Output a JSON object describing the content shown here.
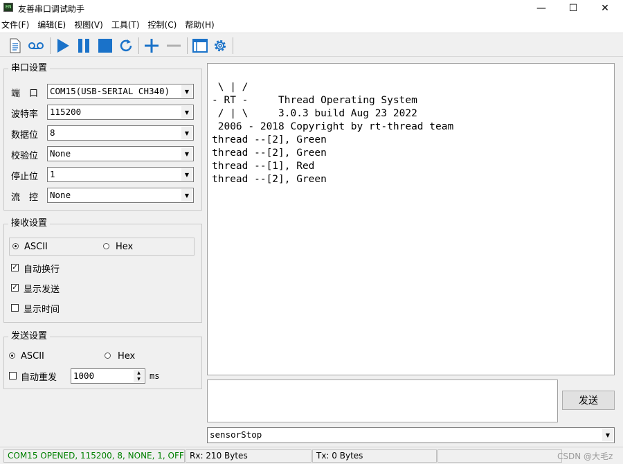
{
  "window": {
    "title": "友善串口调试助手",
    "icon_text": "EN",
    "controls": {
      "minimize": "—",
      "maximize": "☐",
      "close": "✕"
    }
  },
  "menu": [
    "文件(F)",
    "编辑(E)",
    "视图(V)",
    "工具(T)",
    "控制(C)",
    "帮助(H)"
  ],
  "toolbar": {
    "icons": [
      "document-icon",
      "cassette-icon",
      "play-icon",
      "pause-icon",
      "stop-icon",
      "refresh-icon",
      "plus-icon",
      "minus-icon",
      "window-icon",
      "gear-icon"
    ],
    "accent_color": "#1a72c9"
  },
  "serial_settings": {
    "title": "串口设置",
    "port": {
      "label": "端　口",
      "value": "COM15(USB-SERIAL CH340)"
    },
    "baud": {
      "label": "波特率",
      "value": "115200"
    },
    "data_bits": {
      "label": "数据位",
      "value": "8"
    },
    "parity": {
      "label": "校验位",
      "value": "None"
    },
    "stop_bits": {
      "label": "停止位",
      "value": "1"
    },
    "flow": {
      "label": "流　控",
      "value": "None"
    }
  },
  "receive_settings": {
    "title": "接收设置",
    "ascii_label": "ASCII",
    "hex_label": "Hex",
    "selected": "ASCII",
    "auto_wrap": {
      "label": "自动换行",
      "checked": true
    },
    "show_send": {
      "label": "显示发送",
      "checked": true
    },
    "show_time": {
      "label": "显示时间",
      "checked": false
    }
  },
  "send_settings": {
    "title": "发送设置",
    "ascii_label": "ASCII",
    "hex_label": "Hex",
    "selected": "ASCII",
    "auto_resend": {
      "label": "自动重发",
      "checked": false
    },
    "interval_value": "1000",
    "interval_unit": "ms"
  },
  "receive_log": [
    " \\ | /",
    "- RT -     Thread Operating System",
    " / | \\     3.0.3 build Aug 23 2022",
    " 2006 - 2018 Copyright by rt-thread team",
    "thread --[2], Green",
    "thread --[2], Green",
    "thread --[1], Red",
    "thread --[2], Green"
  ],
  "send": {
    "text": "",
    "button_label": "发送",
    "command": "sensorStop"
  },
  "status": {
    "port_status": "COM15 OPENED, 115200, 8, NONE, 1, OFF",
    "port_status_color": "#008000",
    "rx": "Rx: 210 Bytes",
    "tx": "Tx: 0 Bytes",
    "watermark": "CSDN @大毛z"
  }
}
